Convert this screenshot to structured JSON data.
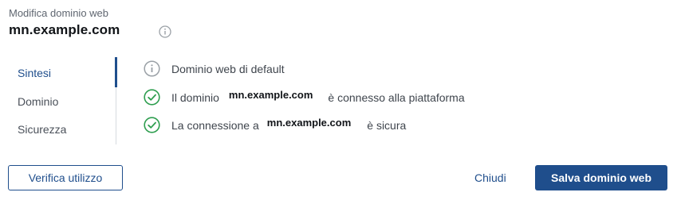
{
  "header": {
    "subtitle": "Modifica dominio web",
    "title": "mn.example.com"
  },
  "tabs": [
    {
      "label": "Sintesi",
      "active": true
    },
    {
      "label": "Dominio",
      "active": false
    },
    {
      "label": "Sicurezza",
      "active": false
    }
  ],
  "status": {
    "row1": {
      "icon": "info-icon",
      "text": "Dominio web di default"
    },
    "row2": {
      "icon": "check-circle-icon",
      "prefix": "Il dominio",
      "domain": "mn.example.com",
      "suffix": "è connesso alla piattaforma"
    },
    "row3": {
      "icon": "check-circle-icon",
      "prefix": "La connessione a",
      "domain": "mn.example.com",
      "suffix": "è sicura"
    }
  },
  "footer": {
    "verify_label": "Verifica utilizzo",
    "close_label": "Chiudi",
    "save_label": "Salva dominio web"
  },
  "colors": {
    "accent": "#1f4e8c",
    "success": "#2e9e4f",
    "info": "#9aa0a6"
  }
}
